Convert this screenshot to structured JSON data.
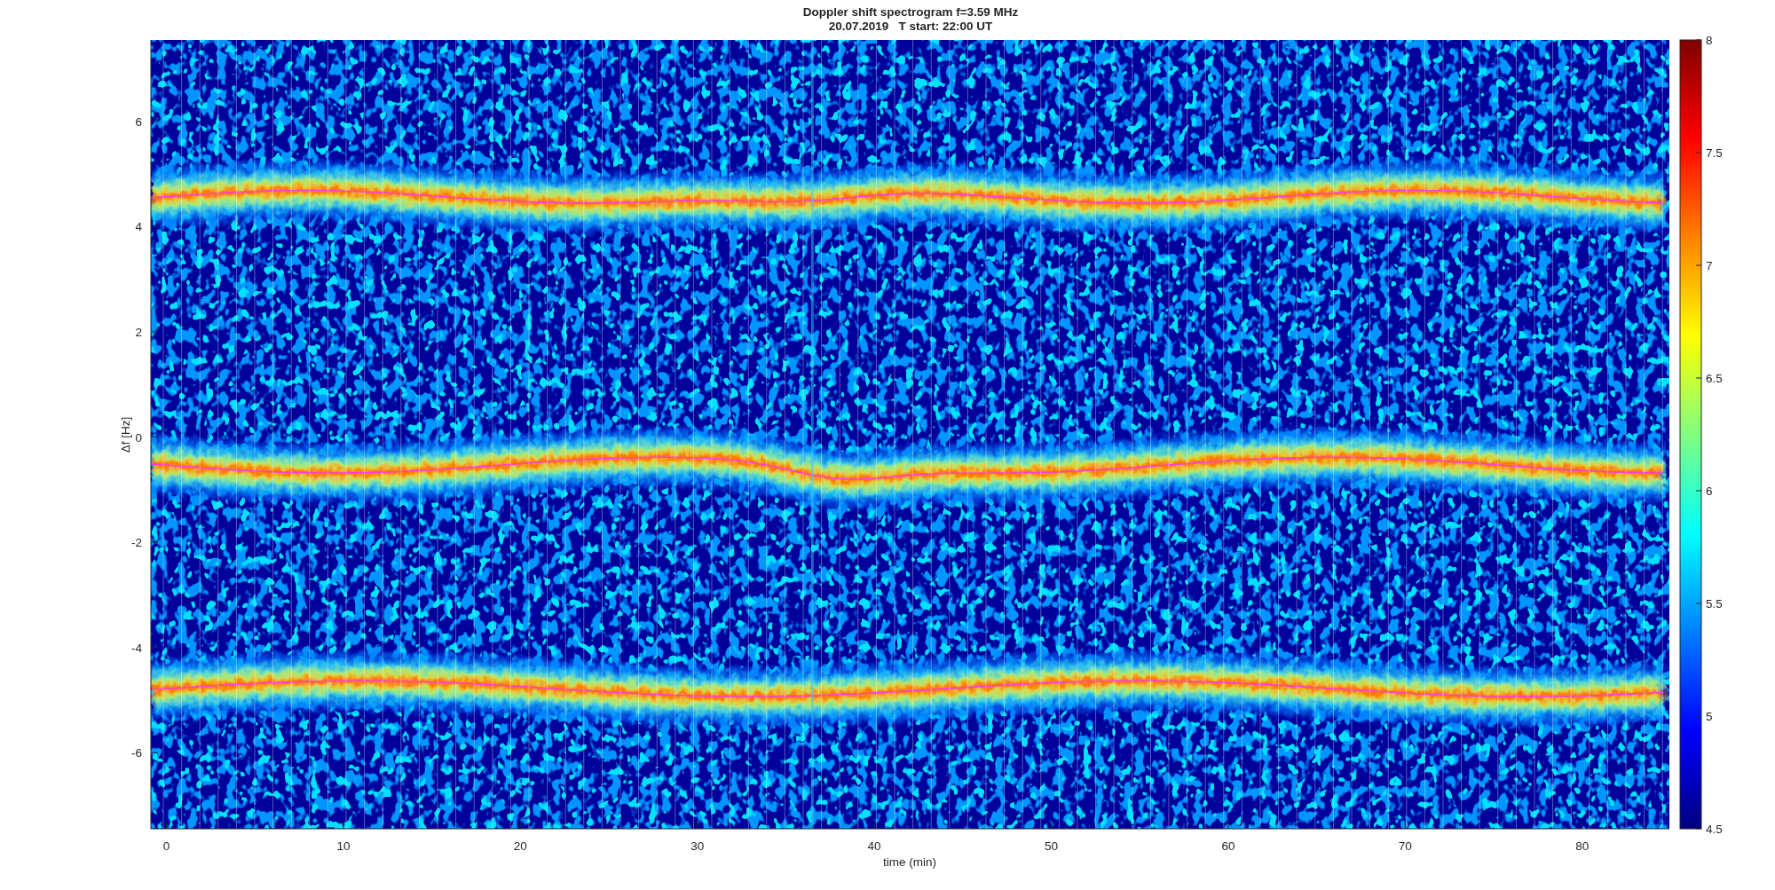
{
  "figure": {
    "title_lines": [
      "Doppler shift spectrogram f=3.59 MHz",
      "20.07.2019   T start: 22:00 UT"
    ]
  },
  "axes": {
    "xlabel": "time (min)",
    "ylabel": "Δf [Hz]",
    "xticks": [
      "0",
      "10",
      "20",
      "30",
      "40",
      "50",
      "60",
      "70",
      "80"
    ],
    "yticks": [
      "6",
      "4",
      "2",
      "0",
      "-2",
      "-4",
      "-6"
    ]
  },
  "colorbar": {
    "ticks": [
      "8",
      "7.5",
      "7",
      "6.5",
      "6",
      "5.5",
      "5",
      "4.5"
    ]
  }
}
